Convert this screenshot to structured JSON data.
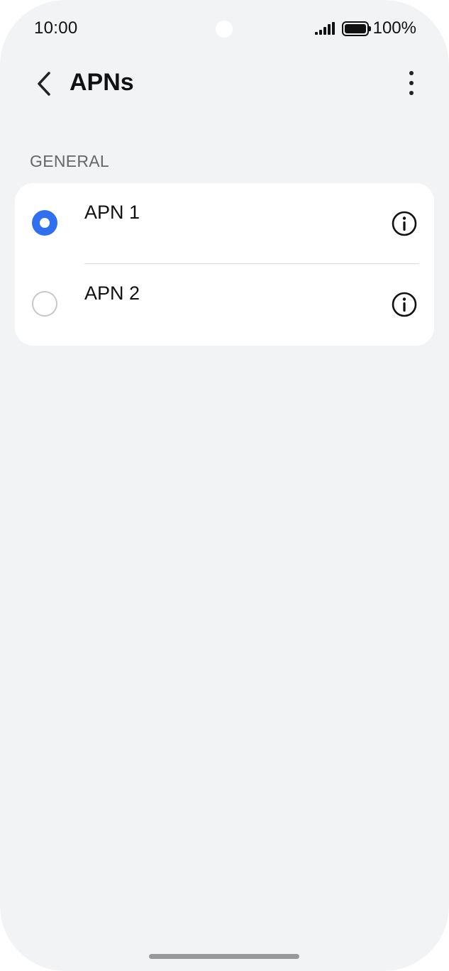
{
  "status_bar": {
    "time": "10:00",
    "battery_text": "100%"
  },
  "header": {
    "title": "APNs"
  },
  "section": {
    "label": "GENERAL"
  },
  "apns": [
    {
      "label": "APN 1",
      "selected": true
    },
    {
      "label": "APN 2",
      "selected": false
    }
  ],
  "colors": {
    "accent": "#2f6ff0",
    "background": "#f2f3f5",
    "card": "#ffffff"
  }
}
